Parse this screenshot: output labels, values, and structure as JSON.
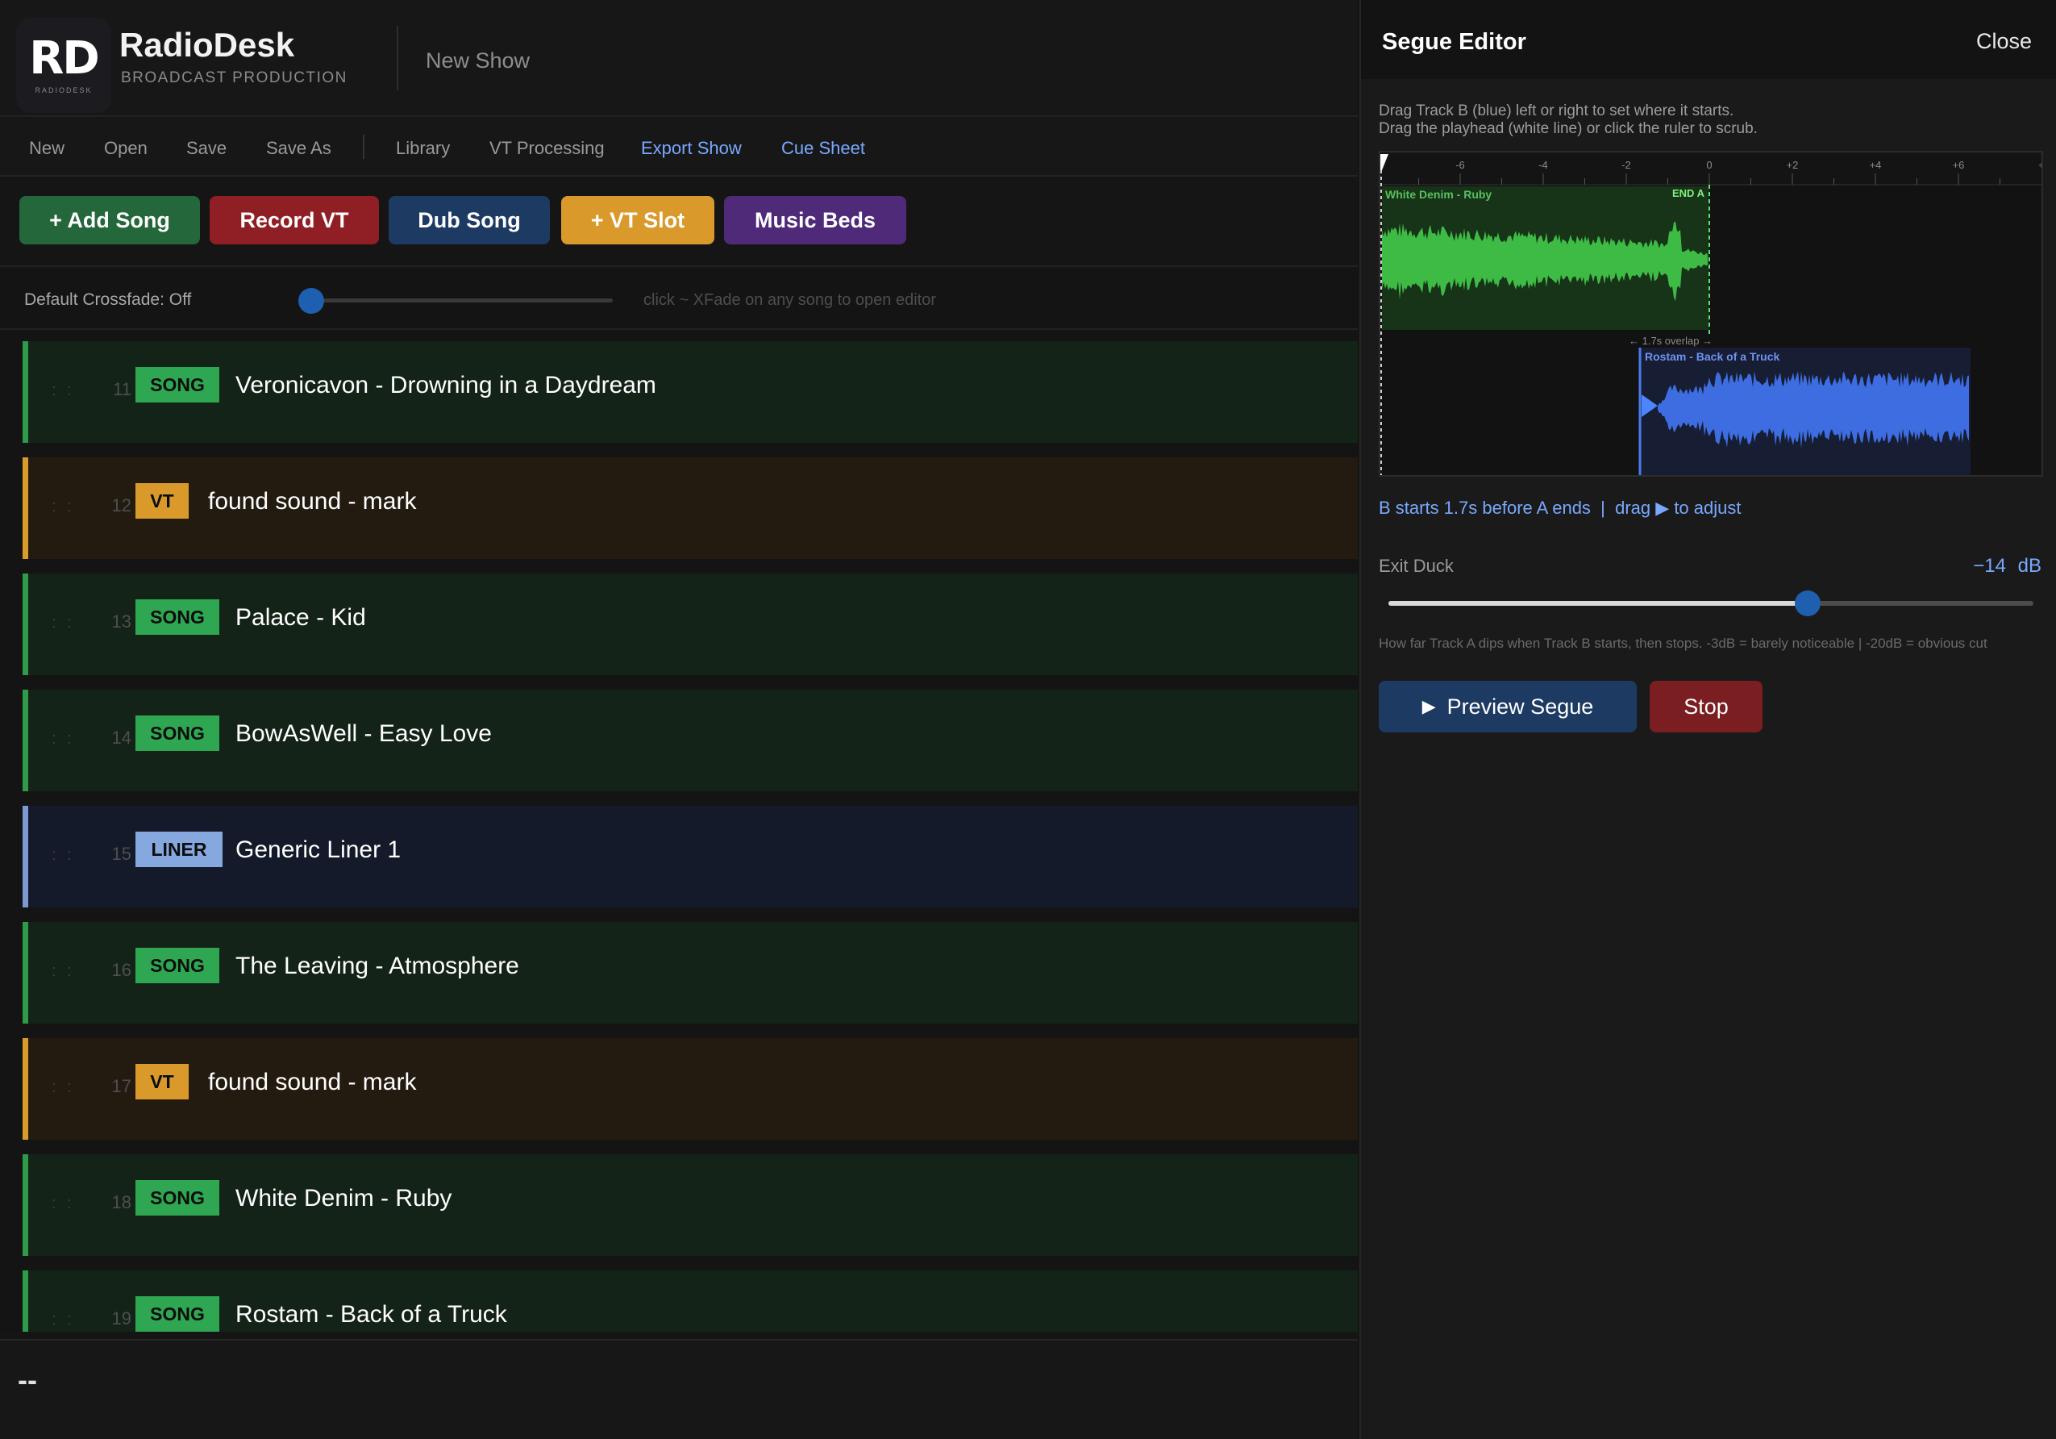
{
  "app": {
    "logo_text": "RD",
    "logo_subtext": "RADIODESK",
    "name": "RadioDesk",
    "subtitle": "BROADCAST PRODUCTION",
    "show_name": "New Show"
  },
  "menu": {
    "new": "New",
    "open": "Open",
    "save": "Save",
    "save_as": "Save As",
    "library": "Library",
    "vt_processing": "VT Processing",
    "export_show": "Export Show",
    "cue_sheet": "Cue Sheet",
    "accent_color": "#79a8ff"
  },
  "toolbar": {
    "add_song": "+ Add Song",
    "record_vt": "Record VT",
    "dub_song": "Dub Song",
    "vt_slot": "+ VT Slot",
    "music_beds": "Music Beds",
    "colors": {
      "add_song": "#23673a",
      "record_vt": "#8f1f25",
      "dub_song": "#1d3a63",
      "vt_slot": "#d99a2b",
      "music_beds": "#4e2a78"
    }
  },
  "crossfade": {
    "label": "Default Crossfade: Off",
    "hint": "click ~ XFade on any song to open editor",
    "value": 0
  },
  "rundown": [
    {
      "num": "11",
      "type": "SONG",
      "title": "Veronicavon - Drowning in a Daydream"
    },
    {
      "num": "12",
      "type": "VT",
      "title": "found sound - mark"
    },
    {
      "num": "13",
      "type": "SONG",
      "title": "Palace - Kid"
    },
    {
      "num": "14",
      "type": "SONG",
      "title": "BowAsWell - Easy Love"
    },
    {
      "num": "15",
      "type": "LINER",
      "title": "Generic Liner 1"
    },
    {
      "num": "16",
      "type": "SONG",
      "title": "The Leaving - Atmosphere"
    },
    {
      "num": "17",
      "type": "VT",
      "title": "found sound - mark"
    },
    {
      "num": "18",
      "type": "SONG",
      "title": "White Denim - Ruby"
    },
    {
      "num": "19",
      "type": "SONG",
      "title": "Rostam - Back of a Truck"
    }
  ],
  "footer": {
    "text": "--"
  },
  "segue_editor": {
    "title": "Segue Editor",
    "close": "Close",
    "instruction_1": "Drag Track B (blue) left or right to set where it starts.",
    "instruction_2": "Drag the playhead (white line) or click the ruler to scrub.",
    "ruler_ticks": [
      "-6",
      "-4",
      "-2",
      "0",
      "+2",
      "+4",
      "+6",
      "+"
    ],
    "track_a": {
      "name": "White Denim - Ruby",
      "end_label": "END A",
      "color": "#3ebb45"
    },
    "track_b": {
      "name": "Rostam - Back of a Truck",
      "color": "#3d6de0"
    },
    "overlap_label": "← 1.7s overlap →",
    "overlap_seconds": 1.7,
    "status": {
      "before": "B starts 1.7s before A ends  |  drag",
      "after": "to adjust"
    },
    "exit_duck": {
      "label": "Exit Duck",
      "value": "−14",
      "unit": "dB",
      "db": -14,
      "min_db": -40,
      "max_db": 0
    },
    "duck_description": "How far Track A dips when Track B starts, then stops.  -3dB = barely noticeable  |  -20dB = obvious cut",
    "preview_button": "Preview Segue",
    "stop_button": "Stop",
    "colors": {
      "preview": "#1d3a63",
      "stop": "#7a1e22"
    }
  }
}
